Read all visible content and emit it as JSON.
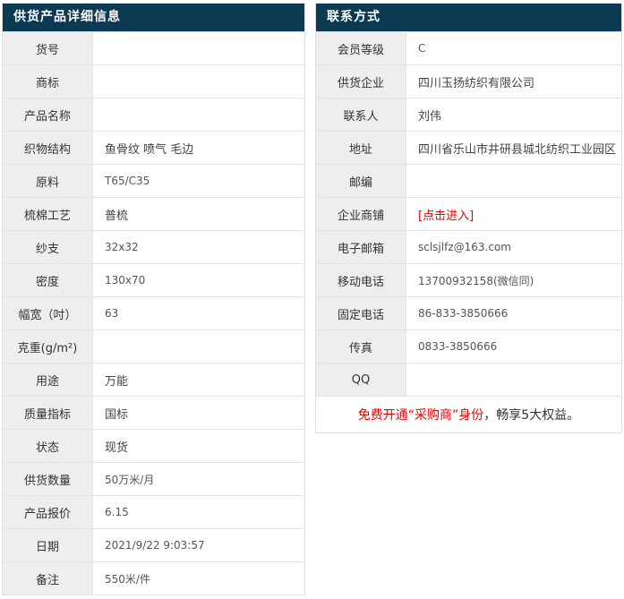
{
  "colors": {
    "header_bg": "#0d3a53",
    "header_text": "#ffffff",
    "label_bg": "#eeeeee",
    "border": "#e4e4e4",
    "value_text": "#555555",
    "label_text": "#333333",
    "red_accent": "#ee0000"
  },
  "product_panel": {
    "title": "供货产品详细信息",
    "rows": [
      {
        "label": "货号",
        "value": ""
      },
      {
        "label": "商标",
        "value": ""
      },
      {
        "label": "产品名称",
        "value": ""
      },
      {
        "label": "织物结构",
        "value": "鱼骨纹 喷气 毛边"
      },
      {
        "label": "原料",
        "value": "T65/C35"
      },
      {
        "label": "梳棉工艺",
        "value": "普梳"
      },
      {
        "label": "纱支",
        "value": "32x32"
      },
      {
        "label": "密度",
        "value": "130x70"
      },
      {
        "label": "幅宽（吋）",
        "value": "63"
      },
      {
        "label": "克重(g/m²)",
        "value": ""
      },
      {
        "label": "用途",
        "value": "万能"
      },
      {
        "label": "质量指标",
        "value": "国标"
      },
      {
        "label": "状态",
        "value": "现货"
      },
      {
        "label": "供货数量",
        "value": "50万米/月"
      },
      {
        "label": "产品报价",
        "value": "6.15"
      },
      {
        "label": "日期",
        "value": "2021/9/22 9:03:57"
      },
      {
        "label": "备注",
        "value": "550米/件"
      }
    ]
  },
  "contact_panel": {
    "title": "联系方式",
    "rows": [
      {
        "label": "会员等级",
        "value": "C"
      },
      {
        "label": "供货企业",
        "value": "四川玉扬纺织有限公司"
      },
      {
        "label": "联系人",
        "value": "刘伟"
      },
      {
        "label": "地址",
        "value": "四川省乐山市井研县城北纺织工业园区"
      },
      {
        "label": "邮编",
        "value": ""
      },
      {
        "label": "企业商铺",
        "value": "[点击进入]"
      },
      {
        "label": "电子邮箱",
        "value": "sclsjlfz@163.com"
      },
      {
        "label": "移动电话",
        "value": "13700932158(微信同)"
      },
      {
        "label": "固定电话",
        "value": "86-833-3850666"
      },
      {
        "label": "传真",
        "value": "0833-3850666"
      },
      {
        "label": "QQ",
        "value": ""
      }
    ],
    "promo": {
      "highlight": "免费开通“采购商”身份",
      "rest": "，畅享5大权益。"
    }
  }
}
